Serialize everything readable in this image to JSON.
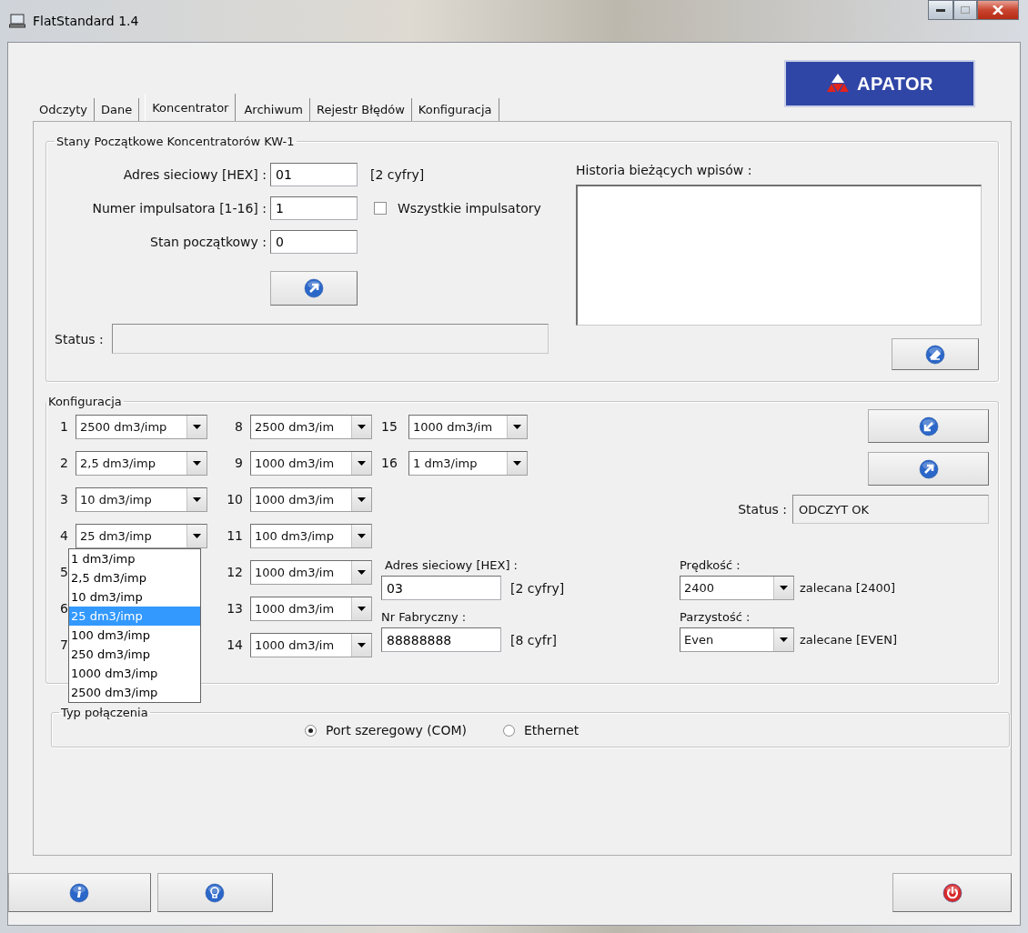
{
  "window": {
    "title": "FlatStandard 1.4"
  },
  "logo": "APATOR",
  "tabs": [
    {
      "label": "Odczyty",
      "selected": false
    },
    {
      "label": "Dane",
      "selected": false
    },
    {
      "label": "Koncentrator",
      "selected": true
    },
    {
      "label": "Archiwum",
      "selected": false
    },
    {
      "label": "Rejestr Błędów",
      "selected": false
    },
    {
      "label": "Konfiguracja",
      "selected": false
    }
  ],
  "initial_states": {
    "title": "Stany Początkowe Koncentratorów KW-1",
    "fields": [
      {
        "label": "Adres sieciowy [HEX] :",
        "value": "01",
        "hint": "[2 cyfry]"
      },
      {
        "label": "Numer impulsatora [1-16] :",
        "value": "1",
        "checkbox": {
          "label": "Wszystkie impulsatory",
          "checked": false
        }
      },
      {
        "label": "Stan początkowy :",
        "value": "0"
      }
    ],
    "status_label": "Status :",
    "history_label": "Historia bieżących wpisów :"
  },
  "configuration": {
    "title": "Konfiguracja",
    "channels": [
      {
        "number": "1",
        "value": "2500 dm3/imp"
      },
      {
        "number": "2",
        "value": "2,5 dm3/imp"
      },
      {
        "number": "3",
        "value": "10 dm3/imp"
      },
      {
        "number": "4",
        "value": "25 dm3/imp",
        "expanded": true
      },
      {
        "number": "5"
      },
      {
        "number": "6"
      },
      {
        "number": "7"
      },
      {
        "number": "8",
        "value": "2500 dm3/im"
      },
      {
        "number": "9",
        "value": "1000 dm3/im"
      },
      {
        "number": "10",
        "value": "1000 dm3/im"
      },
      {
        "number": "11",
        "value": "100 dm3/imp"
      },
      {
        "number": "12",
        "value": "1000 dm3/im"
      },
      {
        "number": "13",
        "value": "1000 dm3/im"
      },
      {
        "number": "14",
        "value": "1000 dm3/im"
      },
      {
        "number": "15",
        "value": "1000 dm3/im"
      },
      {
        "number": "16",
        "value": "1 dm3/imp"
      }
    ],
    "dropdown_options": [
      {
        "label": "1 dm3/imp",
        "selected": false
      },
      {
        "label": "2,5 dm3/imp",
        "selected": false
      },
      {
        "label": "10 dm3/imp",
        "selected": false
      },
      {
        "label": "25 dm3/imp",
        "selected": true
      },
      {
        "label": "100 dm3/imp",
        "selected": false
      },
      {
        "label": "250 dm3/imp",
        "selected": false
      },
      {
        "label": "1000 dm3/imp",
        "selected": false
      },
      {
        "label": "2500 dm3/imp",
        "selected": false
      }
    ],
    "status_label": "Status :",
    "status_value": "ODCZYT OK",
    "address": {
      "label": "Adres sieciowy [HEX] :",
      "value": "03",
      "hint": "[2 cyfry]"
    },
    "serial_number": {
      "label": "Nr Fabryczny :",
      "value": "88888888",
      "hint": "[8 cyfr]"
    },
    "speed": {
      "label": "Prędkość :",
      "value": "2400",
      "hint": "zalecana [2400]"
    },
    "parity": {
      "label": "Parzystość :",
      "value": "Even",
      "hint": "zalecane [EVEN]"
    }
  },
  "connection": {
    "title": "Typ połączenia",
    "options": [
      {
        "label": "Port szeregowy (COM)",
        "selected": true
      },
      {
        "label": "Ethernet",
        "selected": false
      }
    ]
  }
}
